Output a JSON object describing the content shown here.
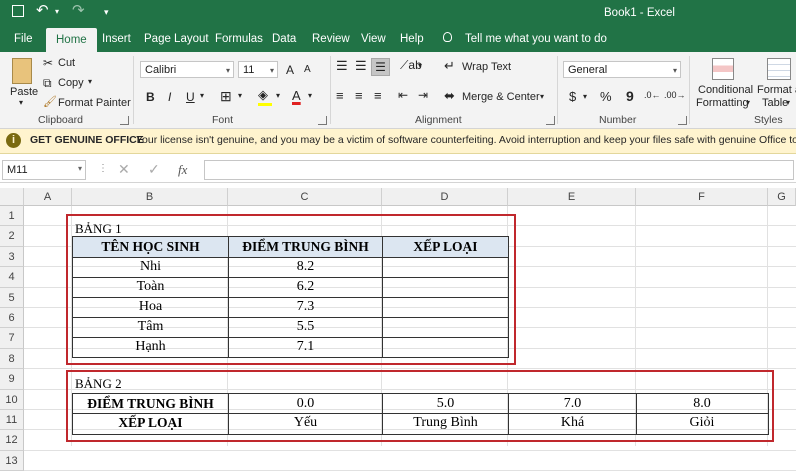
{
  "window": {
    "title": "Book1 - Excel"
  },
  "quick_access": {
    "save_icon": "save-icon",
    "undo_icon": "undo-icon",
    "redo_icon": "redo-icon",
    "customize": "▾"
  },
  "tabs": [
    {
      "label": "File"
    },
    {
      "label": "Home"
    },
    {
      "label": "Insert"
    },
    {
      "label": "Page Layout"
    },
    {
      "label": "Formulas"
    },
    {
      "label": "Data"
    },
    {
      "label": "Review"
    },
    {
      "label": "View"
    },
    {
      "label": "Help"
    }
  ],
  "tell_me": "Tell me what you want to do",
  "ribbon": {
    "clipboard": {
      "paste": "Paste",
      "cut": "Cut",
      "copy": "Copy",
      "format_painter": "Format Painter",
      "label": "Clipboard"
    },
    "font": {
      "name": "Calibri",
      "size": "11",
      "bold": "B",
      "italic": "I",
      "underline": "U",
      "grow": "A",
      "shrink": "A",
      "font_color_glyph": "A",
      "label": "Font"
    },
    "alignment": {
      "wrap_text": "Wrap Text",
      "merge_center": "Merge & Center",
      "label": "Alignment"
    },
    "number": {
      "format": "General",
      "currency": "$",
      "percent": "%",
      "comma": "9",
      "label": "Number"
    },
    "styles": {
      "conditional": "Conditional",
      "formatting": "Formatting",
      "format_as": "Format as",
      "table": "Table",
      "label": "Styles"
    }
  },
  "message_bar": {
    "title": "GET GENUINE OFFICE",
    "text": "Your license isn't genuine, and you may be a victim of software counterfeiting. Avoid interruption and keep your files safe with genuine Office today."
  },
  "formula_bar": {
    "name_box": "M11",
    "fx": "fx",
    "value": ""
  },
  "columns": [
    "A",
    "B",
    "C",
    "D",
    "E",
    "F",
    "G"
  ],
  "rows": [
    "1",
    "2",
    "3",
    "4",
    "5",
    "6",
    "7",
    "8",
    "9",
    "10",
    "11",
    "12",
    "13"
  ],
  "table1": {
    "caption": "BẢNG 1",
    "headers": [
      "TÊN HỌC SINH",
      "ĐIỂM TRUNG BÌNH",
      "XẾP LOẠI"
    ],
    "rows": [
      {
        "name": "Nhi",
        "score": "8.2",
        "rank": ""
      },
      {
        "name": "Toàn",
        "score": "6.2",
        "rank": ""
      },
      {
        "name": "Hoa",
        "score": "7.3",
        "rank": ""
      },
      {
        "name": "Tâm",
        "score": "5.5",
        "rank": ""
      },
      {
        "name": "Hạnh",
        "score": "7.1",
        "rank": ""
      }
    ]
  },
  "table2": {
    "caption": "BẢNG 2",
    "score_label": "ĐIỂM TRUNG BÌNH",
    "rank_label": "XẾP LOẠI",
    "scores": [
      "0.0",
      "5.0",
      "7.0",
      "8.0"
    ],
    "ranks": [
      "Yếu",
      "Trung Bình",
      "Khá",
      "Giỏi"
    ]
  },
  "colors": {
    "excel_green": "#217346",
    "highlight_red": "#c0282d",
    "header_fill": "#dce6f1",
    "message_bg": "#fff4ce"
  }
}
